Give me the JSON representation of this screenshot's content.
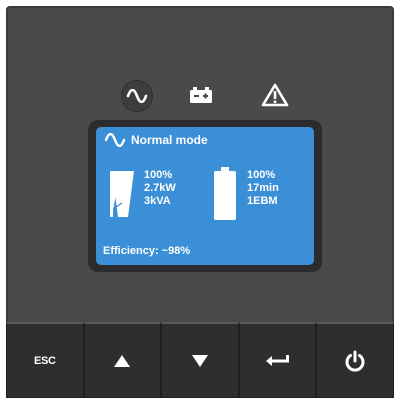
{
  "indicators": [
    {
      "icon": "sine-wave-icon"
    },
    {
      "icon": "battery-icon"
    },
    {
      "icon": "warning-triangle-icon"
    }
  ],
  "screen": {
    "mode_icon": "sine-wave-icon",
    "mode": "Normal mode",
    "load": {
      "icon": "load-gauge-icon",
      "percent": "100%",
      "power_kw": "2.7kW",
      "power_kva": "3kVA"
    },
    "battery": {
      "icon": "battery-level-icon",
      "percent": "100%",
      "runtime": "17min",
      "ebm": "1EBM"
    },
    "efficiency": "Efficiency: ~98%"
  },
  "buttons": {
    "esc_label": "ESC",
    "up_icon": "up-arrow-icon",
    "down_icon": "down-arrow-icon",
    "enter_icon": "enter-icon",
    "power_icon": "power-icon"
  },
  "colors": {
    "panel": "#4a4a4c",
    "screen": "#3b8fd6",
    "buttons": "#2e2e30"
  }
}
